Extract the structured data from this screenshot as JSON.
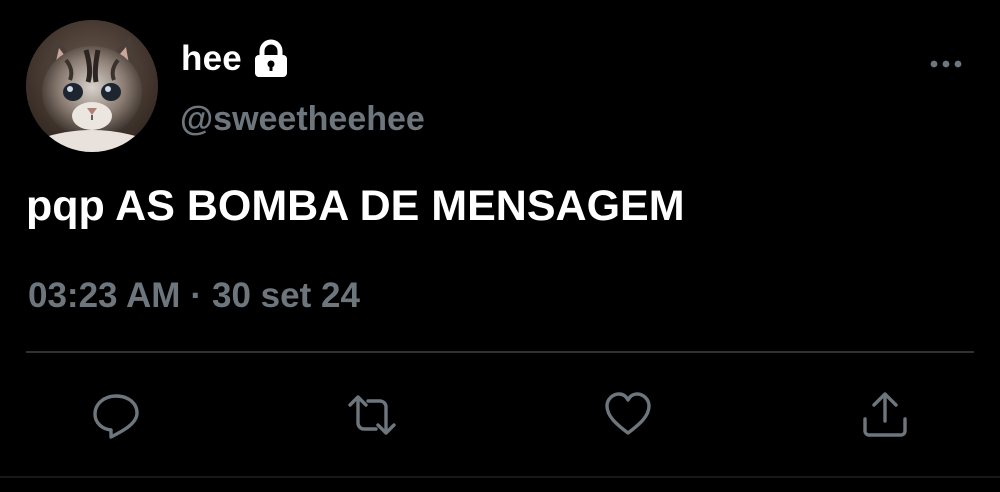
{
  "tweet": {
    "author": {
      "display_name": "hee",
      "handle": "@sweetheehee",
      "protected_icon": "lock-icon",
      "avatar_description_icon": "kitten-avatar"
    },
    "text": "pqp AS BOMBA DE MENSAGEM",
    "time": "03:23 AM",
    "separator": "·",
    "date": "30 set 24",
    "menu_icon": "more-horizontal-icon"
  },
  "actions": [
    {
      "icon": "reply-icon"
    },
    {
      "icon": "retweet-icon"
    },
    {
      "icon": "like-icon"
    },
    {
      "icon": "share-icon"
    }
  ],
  "colors": {
    "background": "#000000",
    "primary_text": "#ffffff",
    "secondary_text": "#6e767d",
    "divider": "#2f3336"
  }
}
